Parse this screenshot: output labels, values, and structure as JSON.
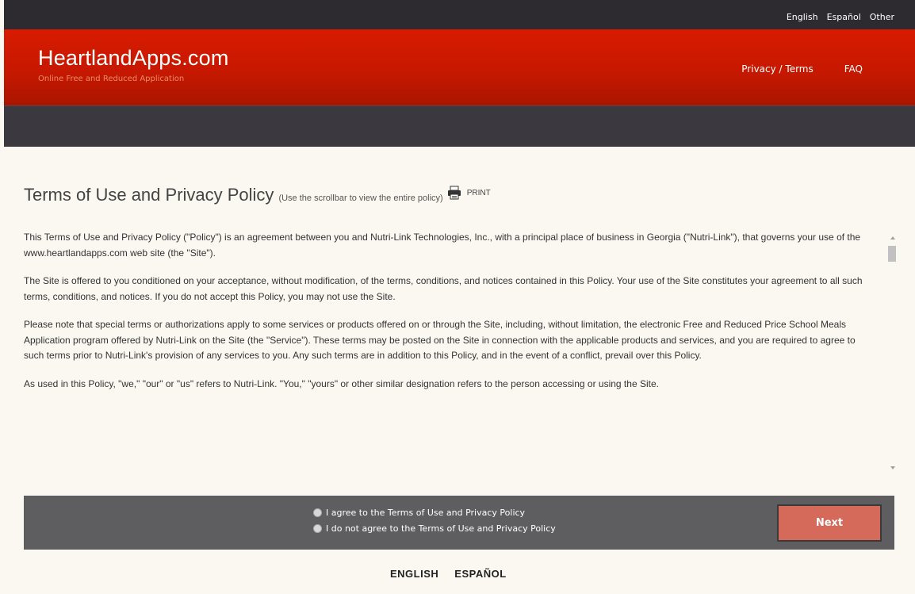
{
  "top_languages": [
    "English",
    "Español",
    "Other"
  ],
  "brand": {
    "title": "HeartlandApps.com",
    "subtitle": "Online Free and Reduced Application"
  },
  "nav": {
    "privacy_terms": "Privacy / Terms",
    "faq": "FAQ"
  },
  "policy": {
    "title": "Terms of Use and Privacy Policy",
    "note": "(Use the scrollbar to view the entire policy)",
    "print_label": "PRINT",
    "paragraphs": [
      "This Terms of Use and Privacy Policy (\"Policy\") is an agreement between you and Nutri-Link Technologies, Inc., with a principal place of business in Georgia (\"Nutri-Link\"), that governs your use of the www.heartlandapps.com web site (the \"Site\").",
      "The Site is offered to you conditioned on your acceptance, without modification, of the terms, conditions, and notices contained in this Policy. Your use of the Site constitutes your agreement to all such terms, conditions, and notices. If you do not accept this Policy, you may not use the Site.",
      "Please note that special terms or authorizations apply to some services or products offered on or through the Site, including, without limitation, the electronic Free and Reduced Price School Meals Application program offered by Nutri-Link on the Site (the \"Service\"). These terms may be posted on the Site in connection with the applicable products and services, and you are required to agree to such terms prior to Nutri-Link's provision of any services to you. Any such terms are in addition to this Policy, and in the event of a conflict, prevail over this Policy.",
      "As used in this Policy, \"we,\" \"our\" or \"us\" refers to Nutri-Link. \"You,\" \"yours\" or other similar designation refers to the person accessing or using the Site."
    ]
  },
  "agreement": {
    "agree": "I agree to the Terms of Use and Privacy Policy",
    "disagree": "I do not agree to the Terms of Use and Privacy Policy",
    "next_label": "Next"
  },
  "bottom_languages": [
    "ENGLISH",
    "ESPAÑOL"
  ],
  "colors": {
    "header_red": "#c71800",
    "dark_bar": "#2d2b30",
    "next_button": "#d66a5a"
  },
  "icons": {
    "print": "printer-icon"
  }
}
